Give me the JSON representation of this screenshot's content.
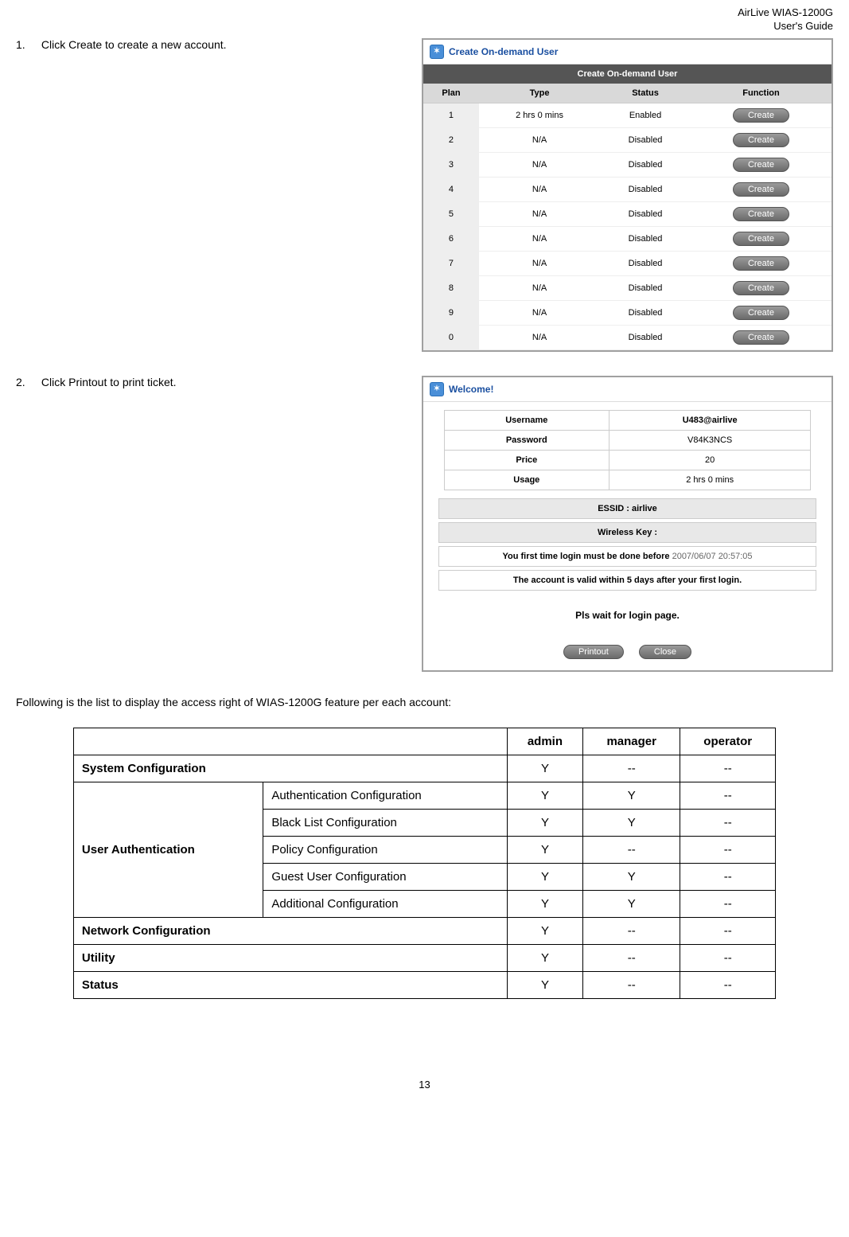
{
  "header": {
    "product": "AirLive WIAS-1200G",
    "doc": "User's Guide"
  },
  "steps": {
    "s1": {
      "num": "1.",
      "text": "Click Create to create a new account."
    },
    "s2": {
      "num": "2.",
      "text": "Click Printout to print ticket."
    }
  },
  "createPanel": {
    "title": "Create On-demand User",
    "caption": "Create On-demand User",
    "cols": {
      "plan": "Plan",
      "type": "Type",
      "status": "Status",
      "function": "Function"
    },
    "btn": "Create",
    "rows": [
      {
        "plan": "1",
        "type": "2 hrs 0 mins",
        "status": "Enabled"
      },
      {
        "plan": "2",
        "type": "N/A",
        "status": "Disabled"
      },
      {
        "plan": "3",
        "type": "N/A",
        "status": "Disabled"
      },
      {
        "plan": "4",
        "type": "N/A",
        "status": "Disabled"
      },
      {
        "plan": "5",
        "type": "N/A",
        "status": "Disabled"
      },
      {
        "plan": "6",
        "type": "N/A",
        "status": "Disabled"
      },
      {
        "plan": "7",
        "type": "N/A",
        "status": "Disabled"
      },
      {
        "plan": "8",
        "type": "N/A",
        "status": "Disabled"
      },
      {
        "plan": "9",
        "type": "N/A",
        "status": "Disabled"
      },
      {
        "plan": "0",
        "type": "N/A",
        "status": "Disabled"
      }
    ]
  },
  "welcomePanel": {
    "title": "Welcome!",
    "username_label": "Username",
    "username_value": "U483@airlive",
    "password_label": "Password",
    "password_value": "V84K3NCS",
    "price_label": "Price",
    "price_value": "20",
    "usage_label": "Usage",
    "usage_value": "2 hrs 0 mins",
    "essid": "ESSID : airlive",
    "wkey": "Wireless Key :",
    "first_login_prefix": "You first time login must be done before ",
    "first_login_date": "2007/06/07 20:57:05",
    "valid": "The account is valid within 5 days after your first login.",
    "wait": "Pls wait for login page.",
    "printout": "Printout",
    "close": "Close"
  },
  "para": "Following is the list to display the access right of WIAS-1200G feature per each account:",
  "rights": {
    "head": {
      "blank": "",
      "admin": "admin",
      "manager": "manager",
      "operator": "operator"
    },
    "rows": [
      {
        "cat": "System Configuration",
        "sub": "",
        "admin": "Y",
        "manager": "--",
        "operator": "--",
        "span": true
      },
      {
        "cat": "User Authentication",
        "sub": "Authentication Configuration",
        "admin": "Y",
        "manager": "Y",
        "operator": "--",
        "groupStart": true,
        "groupSize": 5
      },
      {
        "sub": "Black List Configuration",
        "admin": "Y",
        "manager": "Y",
        "operator": "--"
      },
      {
        "sub": "Policy Configuration",
        "admin": "Y",
        "manager": "--",
        "operator": "--"
      },
      {
        "sub": "Guest User Configuration",
        "admin": "Y",
        "manager": "Y",
        "operator": "--"
      },
      {
        "sub": "Additional Configuration",
        "admin": "Y",
        "manager": "Y",
        "operator": "--"
      },
      {
        "cat": "Network Configuration",
        "sub": "",
        "admin": "Y",
        "manager": "--",
        "operator": "--",
        "span": true
      },
      {
        "cat": "Utility",
        "sub": "",
        "admin": "Y",
        "manager": "--",
        "operator": "--",
        "span": true
      },
      {
        "cat": "Status",
        "sub": "",
        "admin": "Y",
        "manager": "--",
        "operator": "--",
        "span": true
      }
    ]
  },
  "pageNum": "13"
}
